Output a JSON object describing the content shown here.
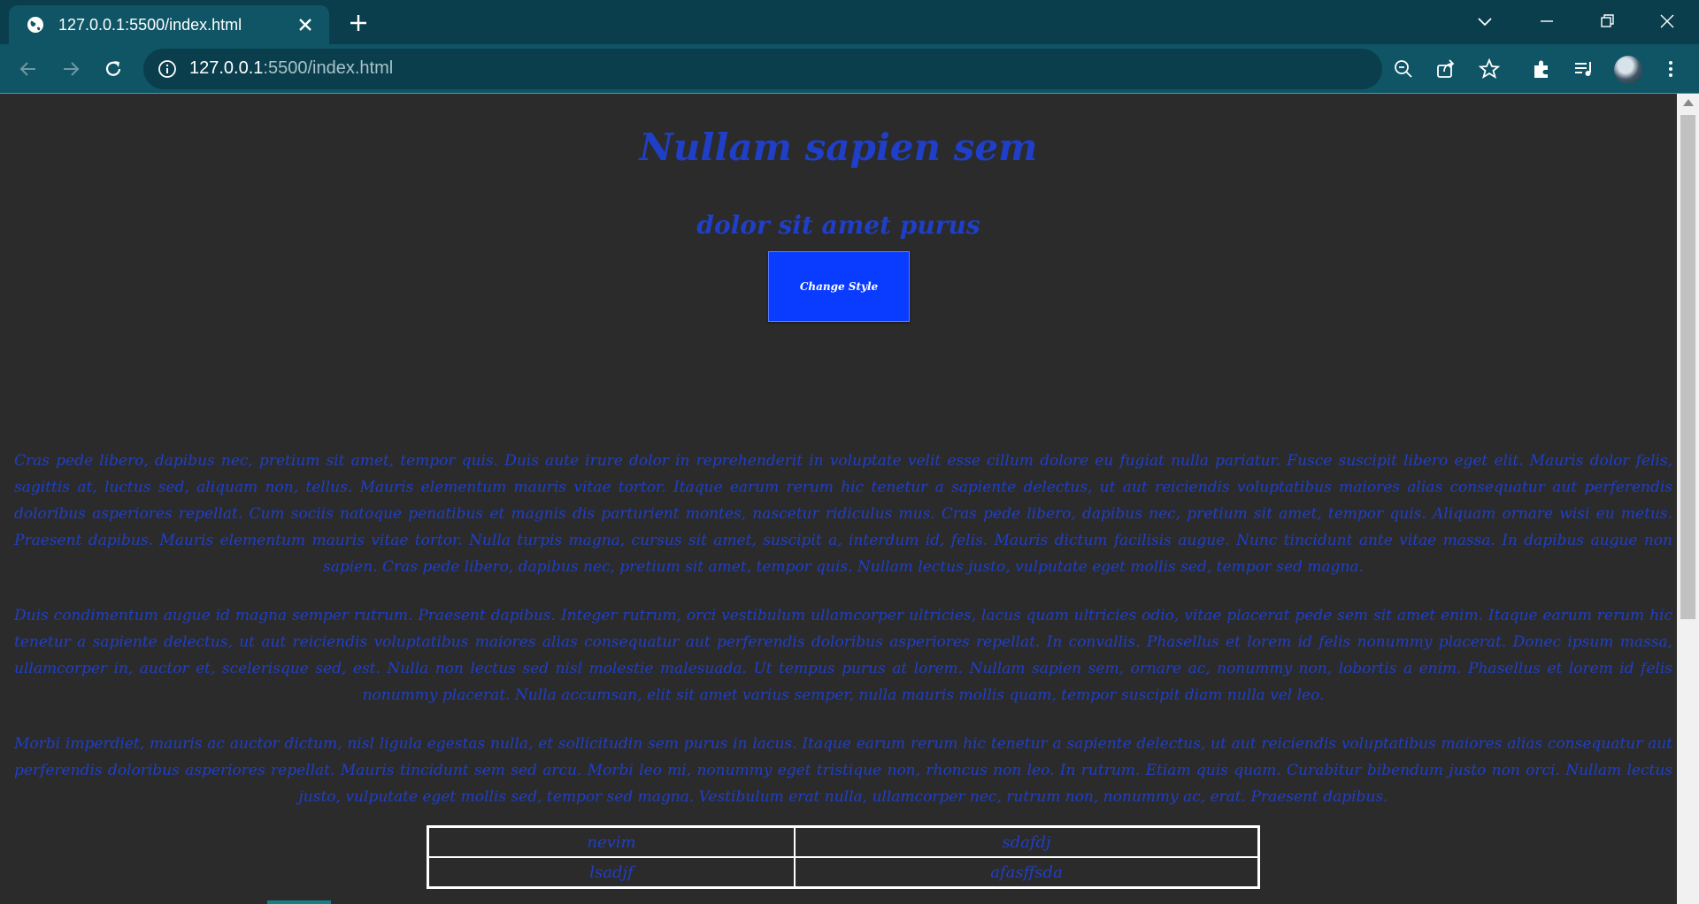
{
  "browser": {
    "tab_title": "127.0.0.1:5500/index.html",
    "url_host": "127.0.0.1",
    "url_rest": ":5500/index.html"
  },
  "page": {
    "title": "Nullam sapien sem",
    "subtitle": "dolor sit amet purus",
    "button_label": "Change Style",
    "paragraphs": [
      "Cras pede libero, dapibus nec, pretium sit amet, tempor quis. Duis aute irure dolor in reprehenderit in voluptate velit esse cillum dolore eu fugiat nulla pariatur. Fusce suscipit libero eget elit. Mauris dolor felis, sagittis at, luctus sed, aliquam non, tellus. Mauris elementum mauris vitae tortor. Itaque earum rerum hic tenetur a sapiente delectus, ut aut reiciendis voluptatibus maiores alias consequatur aut perferendis doloribus asperiores repellat. Cum sociis natoque penatibus et magnis dis parturient montes, nascetur ridiculus mus. Cras pede libero, dapibus nec, pretium sit amet, tempor quis. Aliquam ornare wisi eu metus. Praesent dapibus. Mauris elementum mauris vitae tortor. Nulla turpis magna, cursus sit amet, suscipit a, interdum id, felis. Mauris dictum facilisis augue. Nunc tincidunt ante vitae massa. In dapibus augue non sapien. Cras pede libero, dapibus nec, pretium sit amet, tempor quis. Nullam lectus justo, vulputate eget mollis sed, tempor sed magna.",
      "Duis condimentum augue id magna semper rutrum. Praesent dapibus. Integer rutrum, orci vestibulum ullamcorper ultricies, lacus quam ultricies odio, vitae placerat pede sem sit amet enim. Itaque earum rerum hic tenetur a sapiente delectus, ut aut reiciendis voluptatibus maiores alias consequatur aut perferendis doloribus asperiores repellat. In convallis. Phasellus et lorem id felis nonummy placerat. Donec ipsum massa, ullamcorper in, auctor et, scelerisque sed, est. Nulla non lectus sed nisl molestie malesuada. Ut tempus purus at lorem. Nullam sapien sem, ornare ac, nonummy non, lobortis a enim. Phasellus et lorem id felis nonummy placerat. Nulla accumsan, elit sit amet varius semper, nulla mauris mollis quam, tempor suscipit diam nulla vel leo.",
      "Morbi imperdiet, mauris ac auctor dictum, nisl ligula egestas nulla, et sollicitudin sem purus in lacus. Itaque earum rerum hic tenetur a sapiente delectus, ut aut reiciendis voluptatibus maiores alias consequatur aut perferendis doloribus asperiores repellat. Mauris tincidunt sem sed arcu. Morbi leo mi, nonummy eget tristique non, rhoncus non leo. In rutrum. Etiam quis quam. Curabitur bibendum justo non orci. Nullam lectus justo, vulputate eget mollis sed, tempor sed magna. Vestibulum erat nulla, ullamcorper nec, rutrum non, nonummy ac, erat. Praesent dapibus."
    ],
    "table": [
      [
        "nevim",
        "sdafdj"
      ],
      [
        "lsadjf",
        "afasffsda"
      ]
    ]
  },
  "colors": {
    "accent": "#1f3fc8",
    "button": "#0a3cff",
    "page_bg": "#2b2b2b",
    "chrome": "#0f5566"
  }
}
